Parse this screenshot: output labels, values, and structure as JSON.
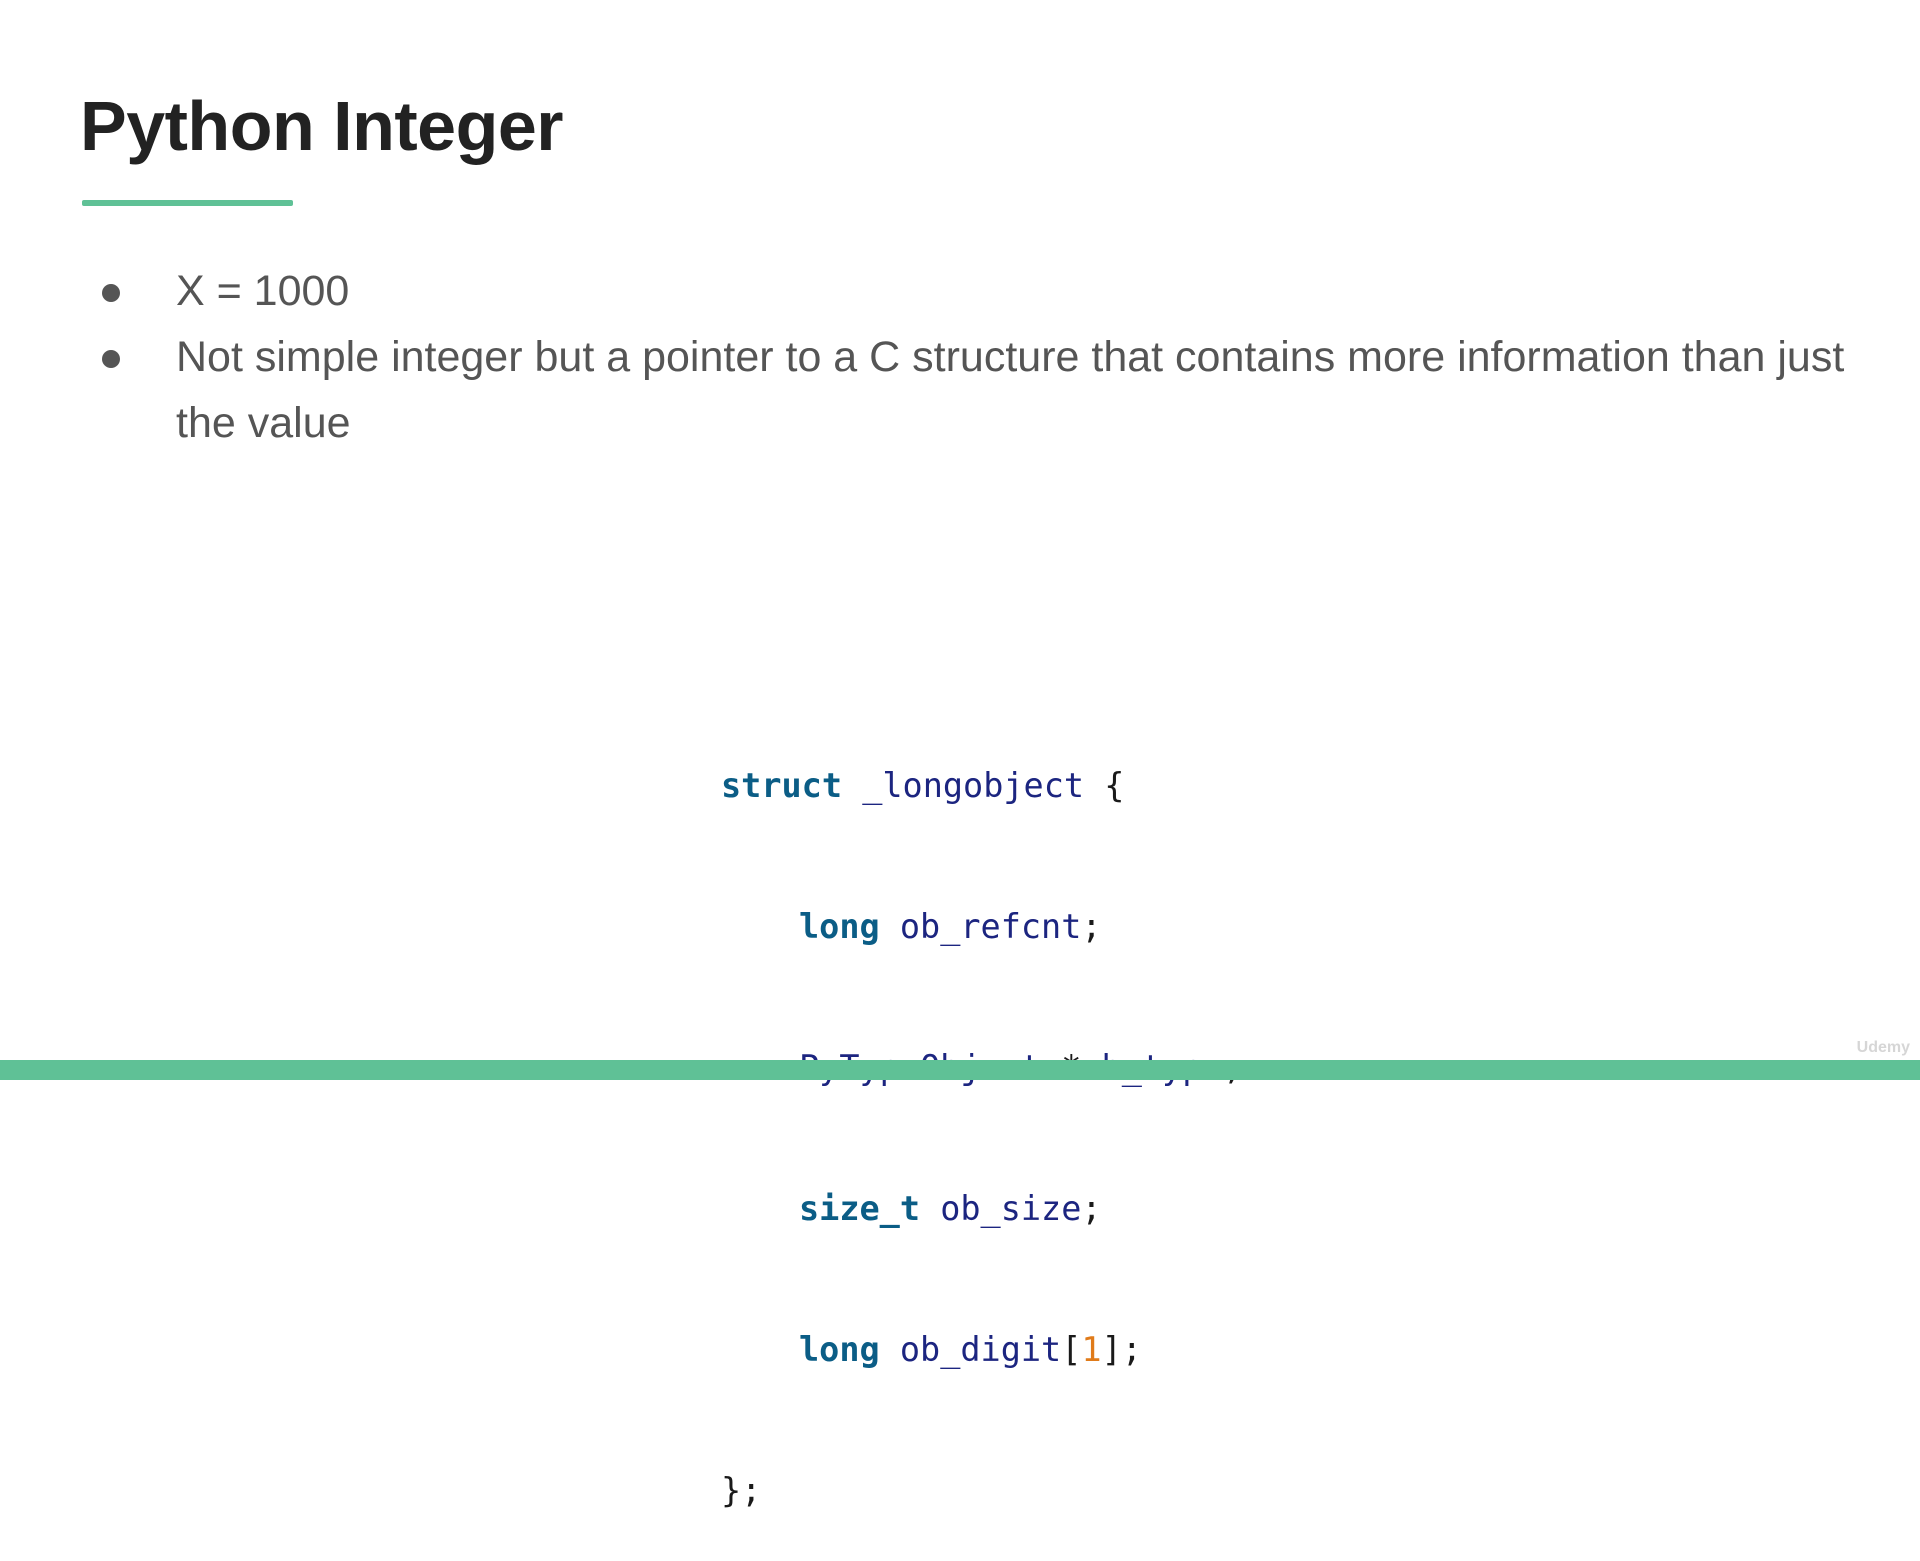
{
  "slide": {
    "title": "Python Integer"
  },
  "bullets": [
    {
      "text": "X = 1000"
    },
    {
      "text": "Not simple integer but a pointer to a C structure that contains more information than just the value"
    }
  ],
  "code": {
    "line1": {
      "keyword": "struct",
      "name": "_longobject",
      "brace": "{"
    },
    "line2": {
      "type": "long",
      "field": "ob_refcnt",
      "end": ";"
    },
    "line3": {
      "type": "PyTypeObject",
      "star": "*",
      "field": "ob_type",
      "end": ";"
    },
    "line4": {
      "type": "size_t",
      "field": "ob_size",
      "end": ";"
    },
    "line5": {
      "type": "long",
      "field": "ob_digit",
      "open": "[",
      "index": "1",
      "close": "];"
    },
    "line6": {
      "close": "};"
    }
  },
  "watermark": "Udemy",
  "colors": {
    "accent": "#5fc196",
    "title": "#222222",
    "body_text": "#555555",
    "code_keyword": "#0b5d86",
    "code_identifier": "#1c2580",
    "code_number": "#e07b1a"
  }
}
